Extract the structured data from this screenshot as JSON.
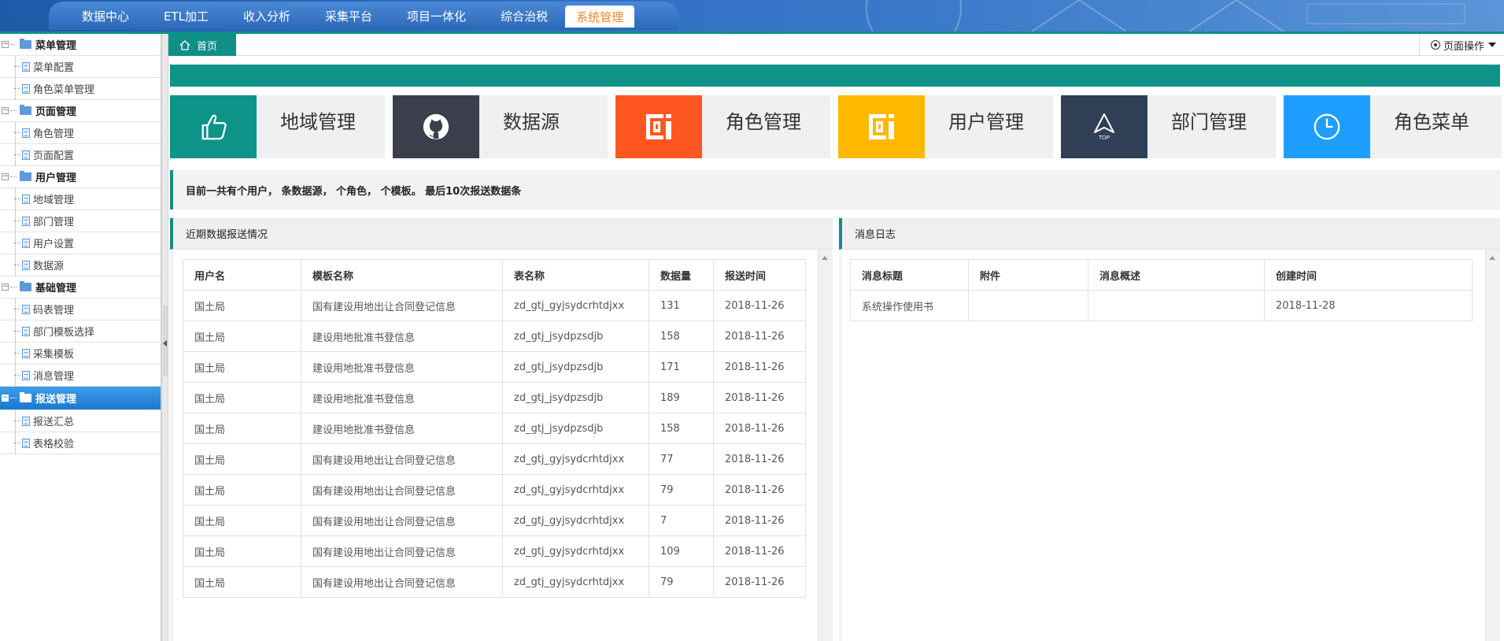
{
  "top_nav": {
    "items": [
      "数据中心",
      "ETL加工",
      "收入分析",
      "采集平台",
      "项目一体化",
      "综合治税",
      "系统管理"
    ],
    "active": "系统管理"
  },
  "sidebar": {
    "groups": [
      {
        "label": "菜单管理",
        "items": [
          "菜单配置",
          "角色菜单管理"
        ]
      },
      {
        "label": "页面管理",
        "items": [
          "角色管理",
          "页面配置"
        ]
      },
      {
        "label": "用户管理",
        "items": [
          "地域管理",
          "部门管理",
          "用户设置",
          "数据源"
        ]
      },
      {
        "label": "基础管理",
        "items": [
          "码表管理",
          "部门模板选择",
          "采集模板",
          "消息管理"
        ]
      },
      {
        "label": "报送管理",
        "items": [
          "报送汇总",
          "表格校验"
        ],
        "active": true
      }
    ]
  },
  "tabs": {
    "home_label": "首页",
    "page_ops_label": "页面操作"
  },
  "cards": [
    {
      "label": "地域管理",
      "color": "#0e9388",
      "icon": "thumbs-up-icon"
    },
    {
      "label": "数据源",
      "color": "#3a3f4b",
      "icon": "github-icon"
    },
    {
      "label": "角色管理",
      "color": "#ff5722",
      "icon": "qrcode-logo-icon"
    },
    {
      "label": "用户管理",
      "color": "#ffb800",
      "icon": "qrcode-logo-icon"
    },
    {
      "label": "部门管理",
      "color": "#2f4056",
      "icon": "top-arrow-icon"
    },
    {
      "label": "角色菜单",
      "color": "#1e9fff",
      "icon": "clock-icon"
    }
  ],
  "stats_text": "目前一共有个用户， 条数据源， 个角色， 个模板。 最后10次报送数据条",
  "report_panel": {
    "title": "近期数据报送情况",
    "columns": [
      "用户名",
      "模板名称",
      "表名称",
      "数据量",
      "报送时间"
    ],
    "rows": [
      [
        "国土局",
        "国有建设用地出让合同登记信息",
        "zd_gtj_gyjsydcrhtdjxx",
        "131",
        "2018-11-26"
      ],
      [
        "国土局",
        "建设用地批准书登信息",
        "zd_gtj_jsydpzsdjb",
        "158",
        "2018-11-26"
      ],
      [
        "国土局",
        "建设用地批准书登信息",
        "zd_gtj_jsydpzsdjb",
        "171",
        "2018-11-26"
      ],
      [
        "国土局",
        "建设用地批准书登信息",
        "zd_gtj_jsydpzsdjb",
        "189",
        "2018-11-26"
      ],
      [
        "国土局",
        "建设用地批准书登信息",
        "zd_gtj_jsydpzsdjb",
        "158",
        "2018-11-26"
      ],
      [
        "国土局",
        "国有建设用地出让合同登记信息",
        "zd_gtj_gyjsydcrhtdjxx",
        "77",
        "2018-11-26"
      ],
      [
        "国土局",
        "国有建设用地出让合同登记信息",
        "zd_gtj_gyjsydcrhtdjxx",
        "79",
        "2018-11-26"
      ],
      [
        "国土局",
        "国有建设用地出让合同登记信息",
        "zd_gtj_gyjsydcrhtdjxx",
        "7",
        "2018-11-26"
      ],
      [
        "国土局",
        "国有建设用地出让合同登记信息",
        "zd_gtj_gyjsydcrhtdjxx",
        "109",
        "2018-11-26"
      ],
      [
        "国土局",
        "国有建设用地出让合同登记信息",
        "zd_gtj_gyjsydcrhtdjxx",
        "79",
        "2018-11-26"
      ]
    ]
  },
  "message_panel": {
    "title": "消息日志",
    "columns": [
      "消息标题",
      "附件",
      "消息概述",
      "创建时间"
    ],
    "rows": [
      [
        "系统操作使用书",
        "",
        "",
        "2018-11-28"
      ]
    ]
  }
}
